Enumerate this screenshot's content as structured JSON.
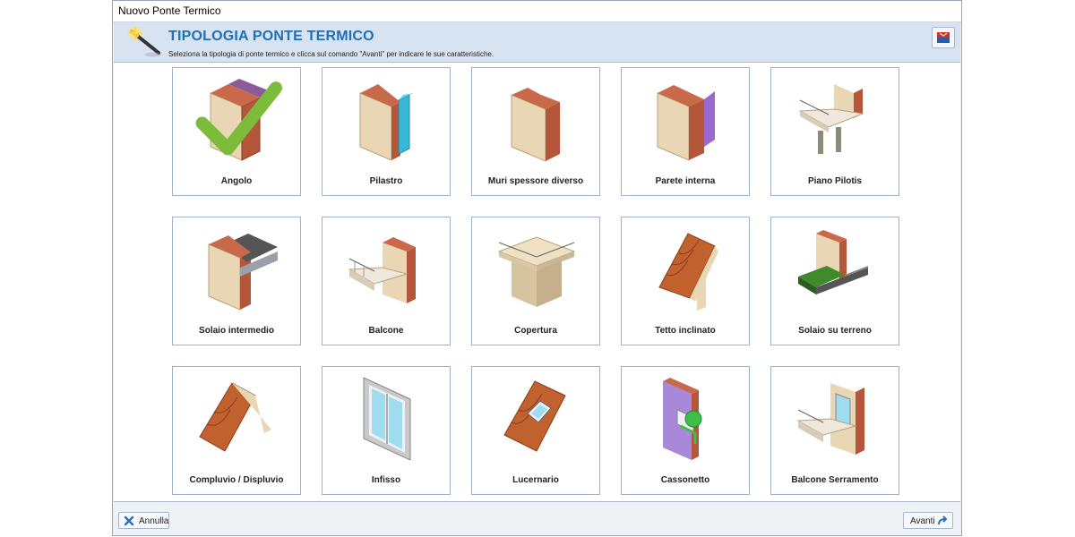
{
  "window": {
    "title": "Nuovo Ponte Termico"
  },
  "header": {
    "title": "TIPOLOGIA PONTE TERMICO",
    "subtitle": "Seleziona la tipologia di ponte termico e clicca sul comando \"Avanti\" per indicare le sue caratteristiche."
  },
  "tiles": [
    {
      "label": "Angolo",
      "icon": "wall-corner-icon",
      "selected": true
    },
    {
      "label": "Pilastro",
      "icon": "pillar-icon"
    },
    {
      "label": "Muri spessore diverso",
      "icon": "walls-different-thickness-icon"
    },
    {
      "label": "Parete interna",
      "icon": "internal-wall-icon"
    },
    {
      "label": "Piano Pilotis",
      "icon": "pilotis-floor-icon"
    },
    {
      "label": "Solaio intermedio",
      "icon": "intermediate-slab-icon"
    },
    {
      "label": "Balcone",
      "icon": "balcony-icon"
    },
    {
      "label": "Copertura",
      "icon": "roof-terrace-icon"
    },
    {
      "label": "Tetto inclinato",
      "icon": "pitched-roof-icon"
    },
    {
      "label": "Solaio su terreno",
      "icon": "ground-slab-icon"
    },
    {
      "label": "Compluvio / Displuvio",
      "icon": "ridge-valley-icon"
    },
    {
      "label": "Infisso",
      "icon": "window-frame-icon"
    },
    {
      "label": "Lucernario",
      "icon": "skylight-icon"
    },
    {
      "label": "Cassonetto",
      "icon": "shutter-box-icon"
    },
    {
      "label": "Balcone Serramento",
      "icon": "balcony-window-icon"
    }
  ],
  "footer": {
    "cancel_label": "Annulla",
    "next_label": "Avanti"
  },
  "colors": {
    "accent": "#1f6fb5",
    "brick": "#b5553a",
    "plaster": "#e8d6b5",
    "tile_border": "#9fb3c8"
  }
}
